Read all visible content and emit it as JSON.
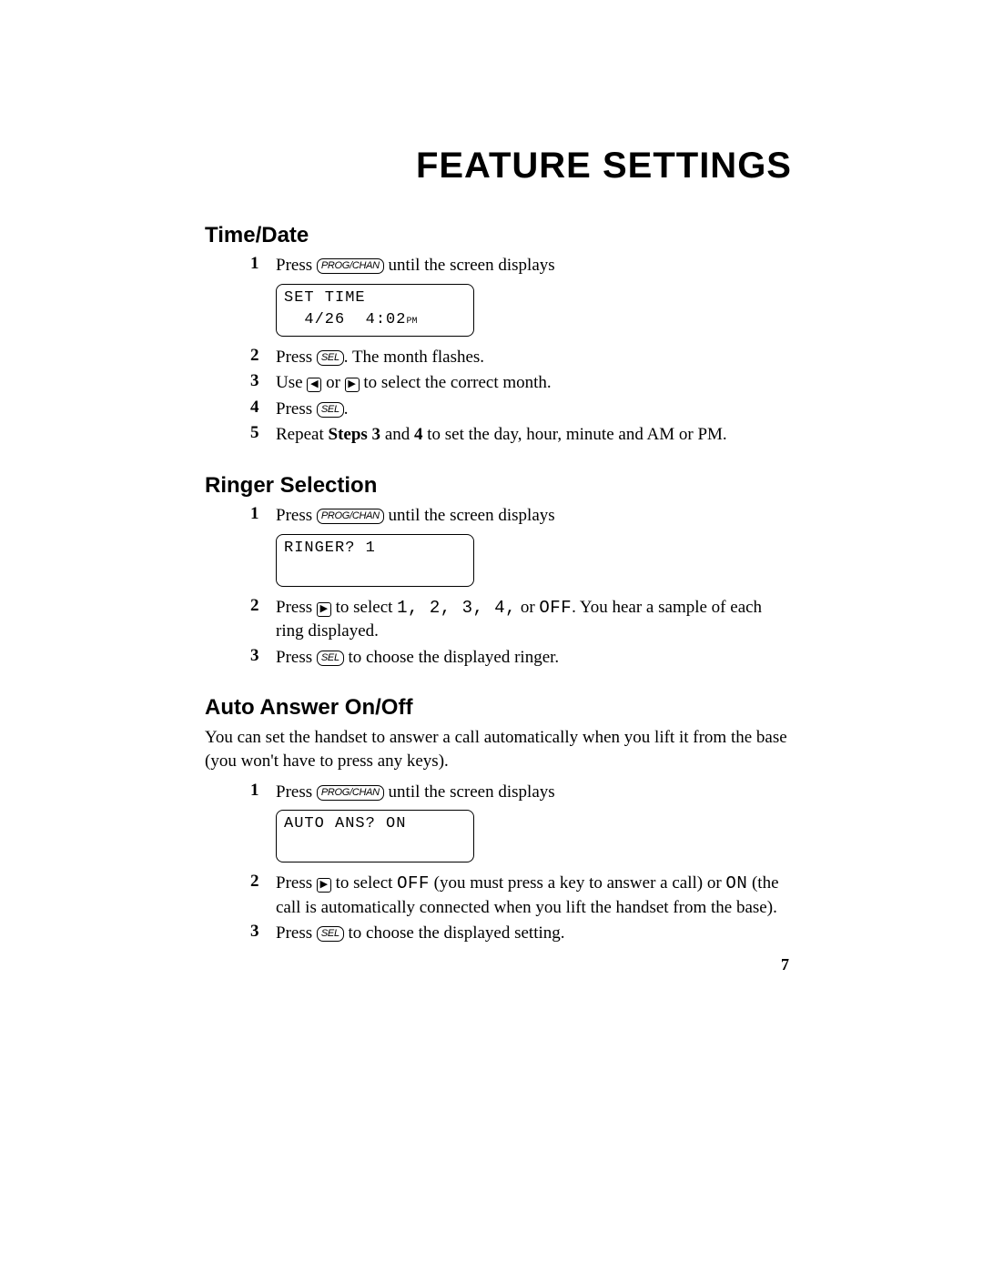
{
  "page_title": "FEATURE SETTINGS",
  "page_number": "7",
  "keys": {
    "progchan": "PROG/CHAN",
    "sel": "SEL",
    "left": "◀",
    "right": "▶"
  },
  "sections": {
    "timedate": {
      "heading": "Time/Date",
      "step1_a": "Press ",
      "step1_b": " until the screen displays",
      "display_line1": "SET TIME",
      "display_line2a": "4/26",
      "display_line2b": "4:02",
      "display_ampm": "PM",
      "step2_a": "Press ",
      "step2_b": ". The month flashes.",
      "step3_a": "Use ",
      "step3_b": " or ",
      "step3_c": " to select the correct month.",
      "step4_a": "Press ",
      "step4_b": ".",
      "step5_a": "Repeat ",
      "step5_bold1": "Steps 3",
      "step5_mid": " and ",
      "step5_bold2": "4",
      "step5_c": " to set the day, hour, minute and AM or PM."
    },
    "ringer": {
      "heading": "Ringer Selection",
      "step1_a": "Press ",
      "step1_b": " until the screen displays",
      "display_line1": "RINGER?  1",
      "step2_a": "Press ",
      "step2_b": " to select ",
      "step2_opts": "1, 2, 3, 4,",
      "step2_c": " or ",
      "step2_off": "OFF",
      "step2_d": ". You hear a sample of each ring displayed.",
      "step3_a": "Press ",
      "step3_b": " to choose the displayed ringer."
    },
    "auto": {
      "heading": "Auto Answer On/Off",
      "intro": "You can set the handset to answer a call automatically when you lift it from the base (you won't have to press any keys).",
      "step1_a": "Press ",
      "step1_b": " until the screen displays",
      "display_line1": "AUTO ANS?  ON",
      "step2_a": "Press ",
      "step2_b": " to select ",
      "step2_off": "OFF",
      "step2_c": " (you must press a key to answer a call) or ",
      "step2_on": "ON",
      "step2_d": " (the call is automatically connected when you lift the handset from the base).",
      "step3_a": "Press ",
      "step3_b": " to choose the displayed setting."
    }
  }
}
